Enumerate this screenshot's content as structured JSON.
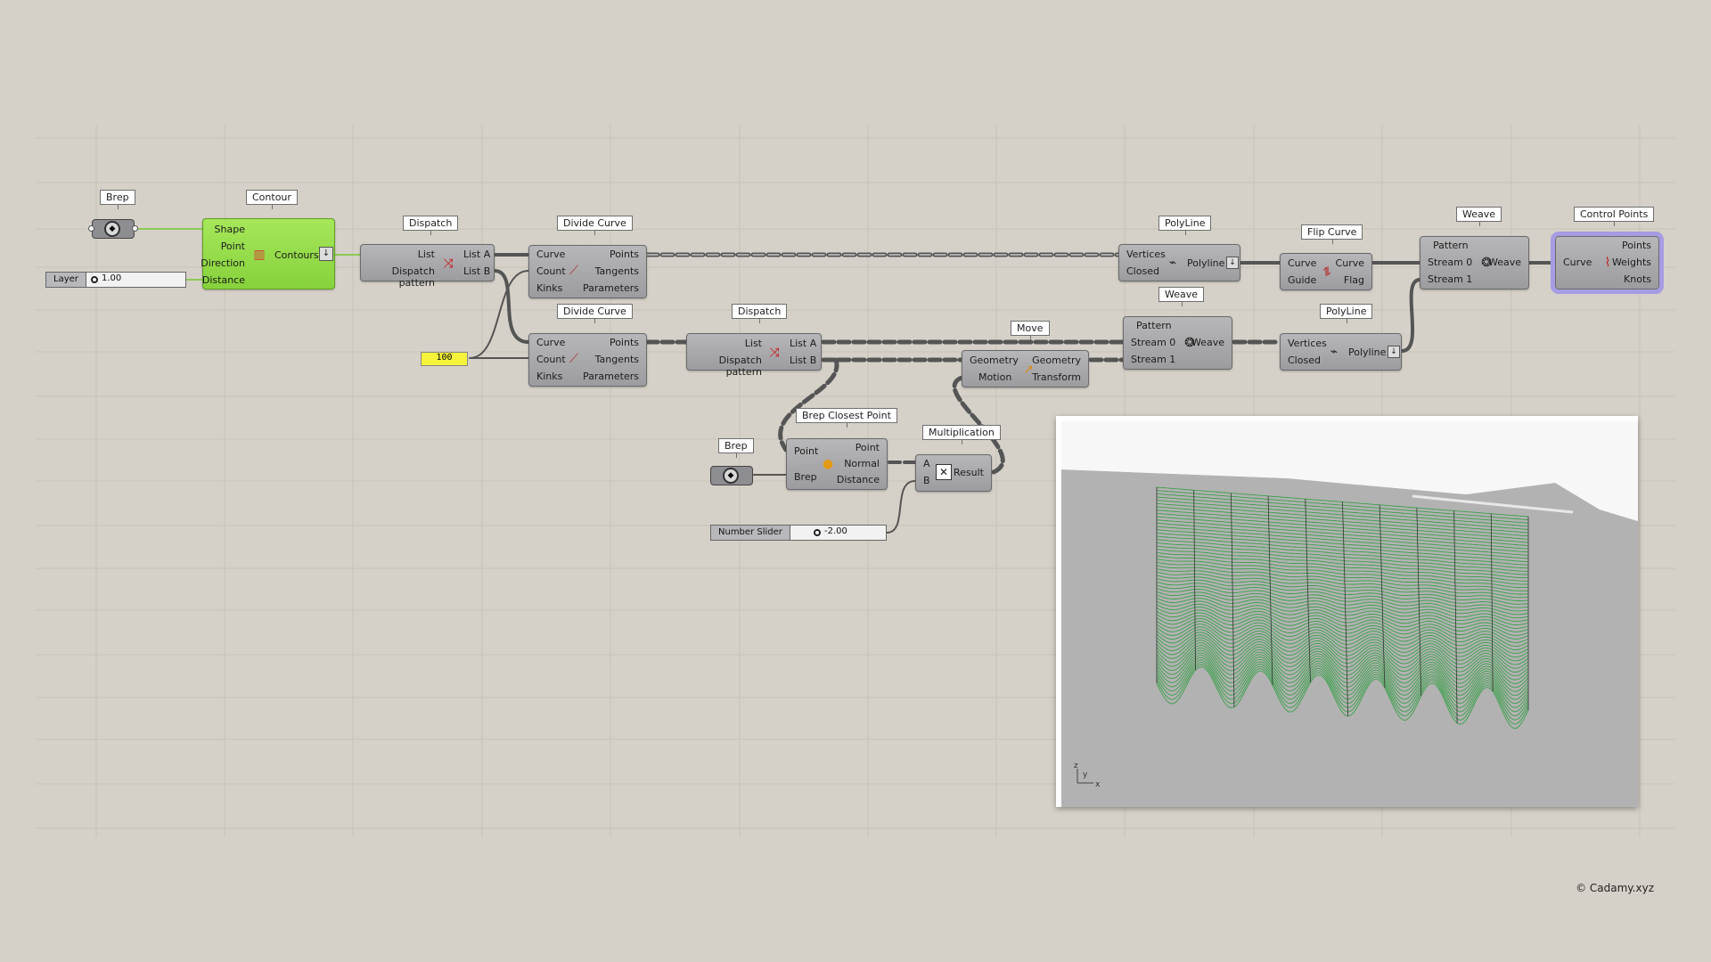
{
  "credit": "© Cadamy.xyz",
  "colors": {
    "canvas": "#d6d1c8",
    "node": "#a9a9ac",
    "node_active": "#98dc4a",
    "selection": "#a59ce3",
    "panel": "#f5f33a",
    "mesh": "#3aa04a"
  },
  "components": {
    "brep1": {
      "tag": "Brep",
      "icon": "brep-icon"
    },
    "brep2": {
      "tag": "Brep",
      "icon": "brep-icon"
    },
    "contour": {
      "tag": "Contour",
      "inputs": [
        "Shape",
        "Point",
        "Direction",
        "Distance"
      ],
      "output": "Contours",
      "icon": "contour-icon"
    },
    "dispatch1": {
      "tag": "Dispatch",
      "inputs": [
        "List",
        "Dispatch pattern"
      ],
      "outputs": [
        "List A",
        "List B"
      ],
      "icon": "dispatch-icon"
    },
    "dispatch2": {
      "tag": "Dispatch",
      "inputs": [
        "List",
        "Dispatch pattern"
      ],
      "outputs": [
        "List A",
        "List B"
      ],
      "icon": "dispatch-icon"
    },
    "divide1": {
      "tag": "Divide Curve",
      "inputs": [
        "Curve",
        "Count",
        "Kinks"
      ],
      "outputs": [
        "Points",
        "Tangents",
        "Parameters"
      ],
      "icon": "divide-curve-icon"
    },
    "divide2": {
      "tag": "Divide Curve",
      "inputs": [
        "Curve",
        "Count",
        "Kinks"
      ],
      "outputs": [
        "Points",
        "Tangents",
        "Parameters"
      ],
      "icon": "divide-curve-icon"
    },
    "polyline1": {
      "tag": "PolyLine",
      "inputs": [
        "Vertices",
        "Closed"
      ],
      "output": "Polyline",
      "icon": "polyline-icon"
    },
    "polyline2": {
      "tag": "PolyLine",
      "inputs": [
        "Vertices",
        "Closed"
      ],
      "output": "Polyline",
      "icon": "polyline-icon"
    },
    "flip": {
      "tag": "Flip Curve",
      "inputs": [
        "Curve",
        "Guide"
      ],
      "outputs": [
        "Curve",
        "Flag"
      ],
      "icon": "flip-curve-icon"
    },
    "weave1": {
      "tag": "Weave",
      "inputs": [
        "Pattern",
        "Stream 0",
        "Stream 1"
      ],
      "output": "Weave",
      "icon": "weave-icon"
    },
    "weave2": {
      "tag": "Weave",
      "inputs": [
        "Pattern",
        "Stream 0",
        "Stream 1"
      ],
      "output": "Weave",
      "icon": "weave-icon"
    },
    "control_points": {
      "tag": "Control Points",
      "input": "Curve",
      "outputs": [
        "Points",
        "Weights",
        "Knots"
      ],
      "icon": "control-points-icon"
    },
    "move": {
      "tag": "Move",
      "inputs": [
        "Geometry",
        "Motion"
      ],
      "outputs": [
        "Geometry",
        "Transform"
      ],
      "icon": "move-icon"
    },
    "brep_closest": {
      "tag": "Brep Closest Point",
      "inputs": [
        "Point",
        "Brep"
      ],
      "outputs": [
        "Point",
        "Normal",
        "Distance"
      ],
      "icon": "closest-point-icon"
    },
    "mult": {
      "tag": "Multiplication",
      "inputs": [
        "A",
        "B"
      ],
      "output": "Result",
      "icon": "multiply-icon"
    }
  },
  "sliders": {
    "layer": {
      "label": "Layer",
      "value": "1.00",
      "level": 0.0
    },
    "number": {
      "label": "Number Slider",
      "value": "-2.00",
      "level": 0.3
    }
  },
  "panel": {
    "value": "100"
  },
  "viewport": {
    "axis_z": "z",
    "axis_y": "y",
    "axis_x": "x",
    "rows": 60,
    "columns": 10
  }
}
